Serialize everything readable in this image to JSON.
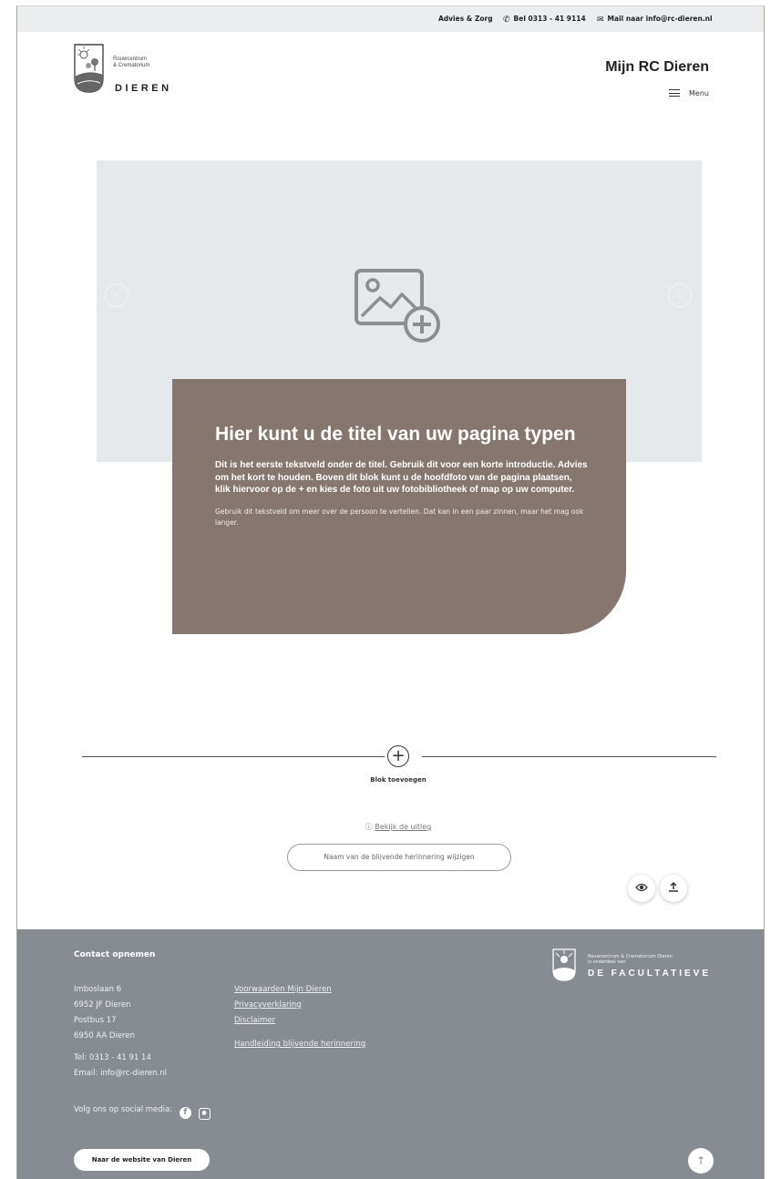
{
  "topbar": {
    "advies": "Advies & Zorg",
    "phone": "Bel 0313 - 41 9114",
    "mail": "Mail naar info@rc-dieren.nl"
  },
  "header": {
    "logo_small_line1": "Rouwcentrum",
    "logo_small_line2": "& Crematorium",
    "logo_big": "DIEREN",
    "account_title": "Mijn RC Dieren",
    "menu_label": "Menu"
  },
  "hero": {
    "add_photo_icon": "image-plus-icon",
    "slide_count": 3
  },
  "card": {
    "title": "Hier kunt u de titel van uw pagina typen",
    "intro": "Dit is het eerste tekstveld onder de titel. Gebruik dit voor een korte introductie. Advies om het kort te houden. Boven dit blok kunt u de hoofdfoto van de pagina plaatsen, klik hiervoor op de + en kies de foto uit uw fotobibliotheek of map op uw computer.",
    "body": "Gebruik dit tekstveld om meer over de persoon te vertellen. Dat kan in een paar zinnen, maar het mag ook langer."
  },
  "editor": {
    "add_block_label": "Blok toevoegen",
    "help_link": "Bekijk de uitleg",
    "rename_button": "Naam van de blijvende herinnering wijzigen"
  },
  "footer": {
    "contact_heading": "Contact opnemen",
    "address": [
      "Imboslaan 6",
      "6952 JF Dieren",
      "Postbus 17",
      "6950 AA Dieren"
    ],
    "tel": "Tel: 0313 - 41 91 14",
    "email": "Email: info@rc-dieren.nl",
    "links": [
      "Voorwaarden Mijn Dieren",
      "Privacyverklaring",
      "Disclaimer"
    ],
    "manual_link": "Handleiding blijvende herinnering",
    "social_label": "Volg ons op social media:",
    "site_button": "Naar de website van Dieren",
    "logo_small_line1": "Rouwcentrum & Crematorium Dieren",
    "logo_small_line2": "is onderdeel van",
    "logo_big": "DE FACULTATIEVE"
  },
  "colors": {
    "card_bg": "#85776f",
    "hero_bg": "#e6e9ec",
    "footer_bg": "#878c93",
    "topbar_bg": "#ecedee"
  }
}
